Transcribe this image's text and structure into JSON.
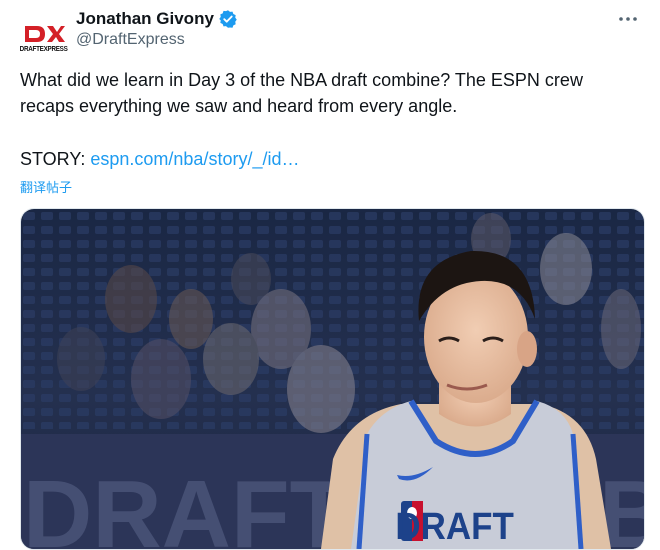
{
  "tweet": {
    "author": {
      "display_name": "Jonathan Givony",
      "handle": "@DraftExpress",
      "avatar_caption": "DRAFTEXPRESS",
      "verified": true
    },
    "text": "What did we learn in Day 3 of the NBA draft combine? The ESPN crew recaps everything we saw and heard from every angle.",
    "story_prefix": "STORY: ",
    "story_link": "espn.com/nba/story/_/id…",
    "translate_label": "翻译帖子",
    "media": {
      "jersey_text": "DRAFT",
      "banner_text": "DRAFT COMBINE"
    }
  },
  "colors": {
    "link": "#1d9bf0",
    "brand_red": "#d42027",
    "verified": "#1d9bf0"
  },
  "icons": {
    "more": "more-dots-icon",
    "verified": "verified-badge-icon"
  }
}
